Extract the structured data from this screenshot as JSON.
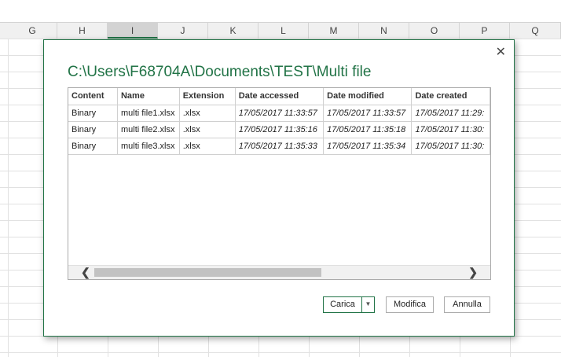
{
  "sheet": {
    "columns": [
      "G",
      "H",
      "I",
      "J",
      "K",
      "L",
      "M",
      "N",
      "O",
      "P",
      "Q"
    ],
    "selected_column": "I"
  },
  "dialog": {
    "title": "C:\\Users\\F68704A\\Documents\\TEST\\Multi file",
    "close_glyph": "✕",
    "table": {
      "headers": [
        "Content",
        "Name",
        "Extension",
        "Date accessed",
        "Date modified",
        "Date created"
      ],
      "rows": [
        [
          "Binary",
          "multi file1.xlsx",
          ".xlsx",
          "17/05/2017 11:33:57",
          "17/05/2017 11:33:57",
          "17/05/2017 11:29:"
        ],
        [
          "Binary",
          "multi file2.xlsx",
          ".xlsx",
          "17/05/2017 11:35:16",
          "17/05/2017 11:35:18",
          "17/05/2017 11:30:"
        ],
        [
          "Binary",
          "multi file3.xlsx",
          ".xlsx",
          "17/05/2017 11:35:33",
          "17/05/2017 11:35:34",
          "17/05/2017 11:30:"
        ]
      ]
    },
    "scroll_left_glyph": "❮",
    "scroll_right_glyph": "❯",
    "buttons": {
      "carica": "Carica",
      "carica_dropdown": "▼",
      "modifica": "Modifica",
      "annulla": "Annulla"
    }
  },
  "colors": {
    "accent": "#217346"
  }
}
